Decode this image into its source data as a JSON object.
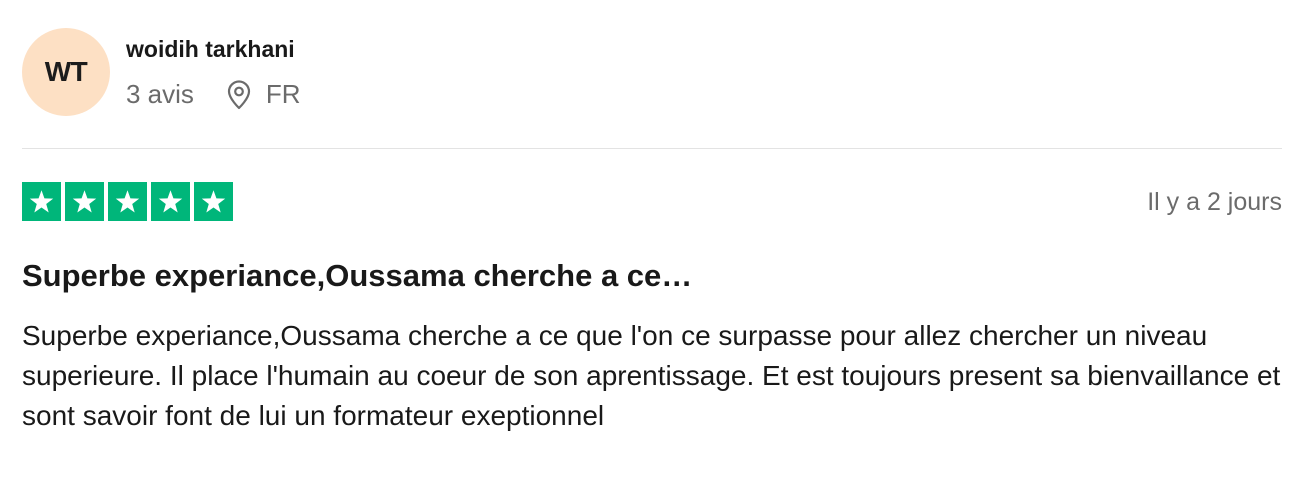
{
  "reviewer": {
    "initials": "WT",
    "name": "woidih tarkhani",
    "review_count": "3 avis",
    "location_icon": "location-pin-icon",
    "country": "FR",
    "avatar_color": "#fde0c4"
  },
  "review": {
    "rating": 5,
    "rating_max": 5,
    "star_color": "#00b67a",
    "date": "Il y a 2 jours",
    "title": "Superbe experiance,Oussama cherche a ce…",
    "body": "Superbe experiance,Oussama cherche a ce que l'on ce surpasse pour allez chercher un niveau superieure. Il place l'humain au coeur de son aprentissage. Et est toujours present sa bienvaillance et sont savoir font de lui un formateur exeptionnel"
  }
}
